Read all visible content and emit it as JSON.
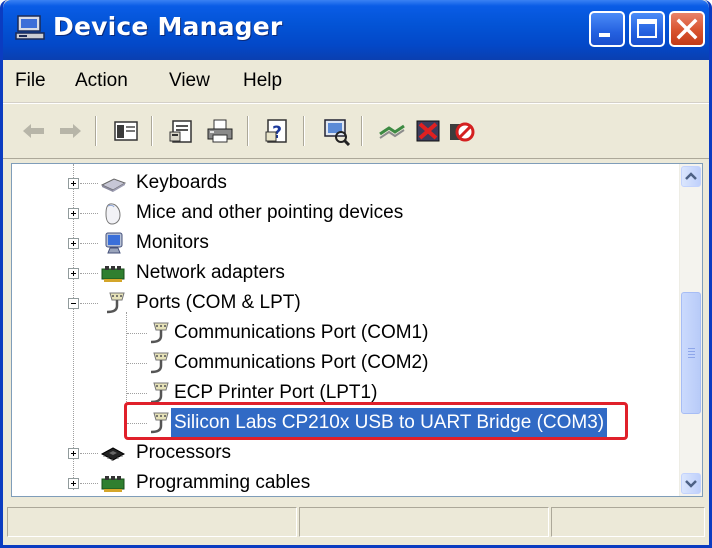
{
  "window": {
    "title": "Device Manager",
    "controls": [
      "minimize",
      "maximize",
      "close"
    ]
  },
  "menu": {
    "items": [
      "File",
      "Action",
      "View",
      "Help"
    ]
  },
  "toolbar": {
    "icons": [
      "back-arrow-icon",
      "forward-arrow-icon",
      "show-hide-console-tree-icon",
      "properties-icon",
      "print-icon",
      "help-icon",
      "scan-hardware-icon",
      "update-driver-icon",
      "uninstall-icon",
      "disable-icon"
    ]
  },
  "tree": {
    "items": [
      {
        "label": "Keyboards",
        "expander": "plus",
        "icon": "keyboard-icon"
      },
      {
        "label": "Mice and other pointing devices",
        "expander": "plus",
        "icon": "mouse-icon"
      },
      {
        "label": "Monitors",
        "expander": "plus",
        "icon": "monitor-icon"
      },
      {
        "label": "Network adapters",
        "expander": "plus",
        "icon": "network-adapter-icon"
      },
      {
        "label": "Ports (COM & LPT)",
        "expander": "minus",
        "icon": "port-icon"
      },
      {
        "label": "Communications Port (COM1)",
        "expander": "none",
        "icon": "port-icon"
      },
      {
        "label": "Communications Port (COM2)",
        "expander": "none",
        "icon": "port-icon"
      },
      {
        "label": "ECP Printer Port (LPT1)",
        "expander": "none",
        "icon": "port-icon"
      },
      {
        "label": "Silicon Labs CP210x USB to UART Bridge (COM3)",
        "expander": "none",
        "icon": "port-icon",
        "selected": true
      },
      {
        "label": "Processors",
        "expander": "plus",
        "icon": "processor-icon"
      },
      {
        "label": "Programming cables",
        "expander": "plus",
        "icon": "network-adapter-icon"
      }
    ]
  },
  "colors": {
    "titlebar": "#0354d6",
    "selection": "#316ac5",
    "highlight_border": "#e0202a"
  }
}
